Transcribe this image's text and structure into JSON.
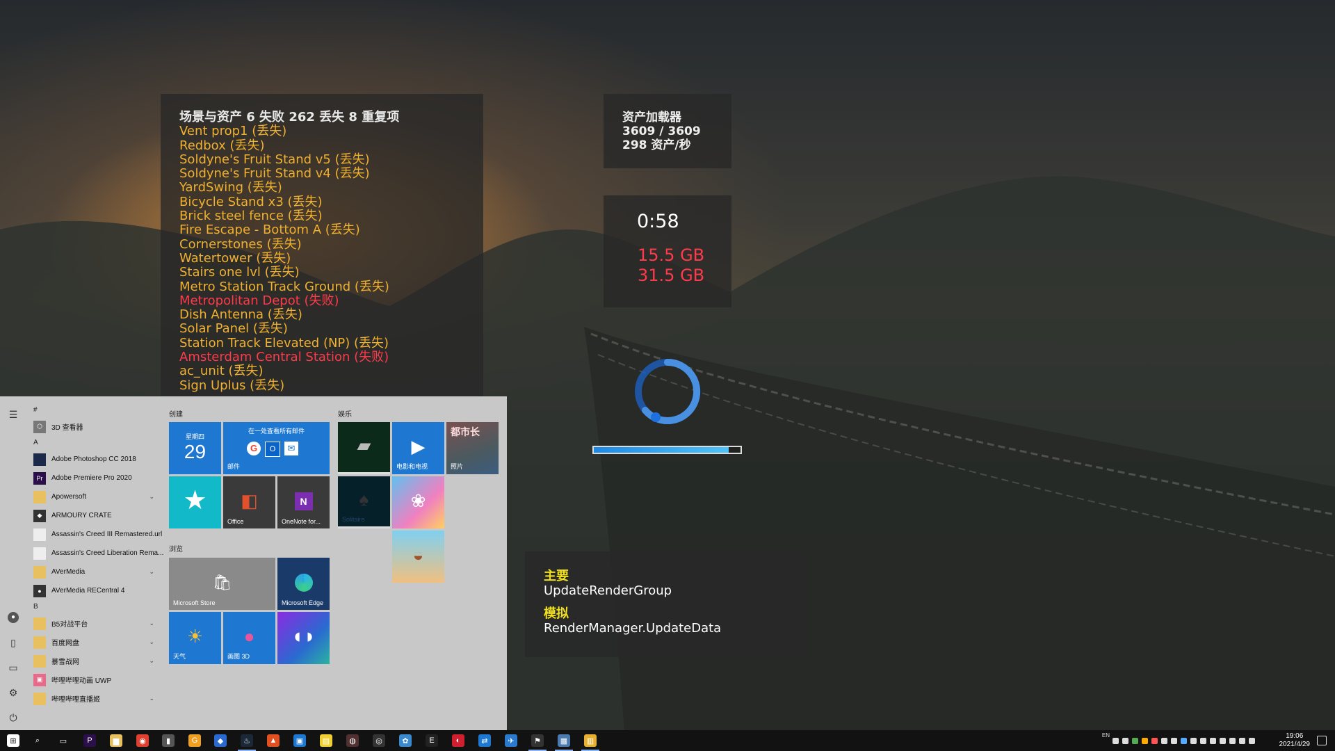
{
  "assets_panel": {
    "header": "场景与资产 6 失败 262 丢失 8 重复项",
    "items": [
      {
        "text": "Vent prop1 (丢失)",
        "status": "ok"
      },
      {
        "text": "Redbox (丢失)",
        "status": "ok"
      },
      {
        "text": "Soldyne's Fruit Stand v5 (丢失)",
        "status": "ok"
      },
      {
        "text": "Soldyne's Fruit Stand v4 (丢失)",
        "status": "ok"
      },
      {
        "text": "YardSwing (丢失)",
        "status": "ok"
      },
      {
        "text": "Bicycle Stand x3 (丢失)",
        "status": "ok"
      },
      {
        "text": "Brick steel fence (丢失)",
        "status": "ok"
      },
      {
        "text": "Fire Escape - Bottom A (丢失)",
        "status": "ok"
      },
      {
        "text": "Cornerstones (丢失)",
        "status": "ok"
      },
      {
        "text": "Watertower (丢失)",
        "status": "ok"
      },
      {
        "text": "Stairs one lvl (丢失)",
        "status": "ok"
      },
      {
        "text": "Metro Station Track Ground (丢失)",
        "status": "ok"
      },
      {
        "text": "Metropolitan Depot (失败)",
        "status": "fail"
      },
      {
        "text": "Dish Antenna (丢失)",
        "status": "ok"
      },
      {
        "text": "Solar Panel (丢失)",
        "status": "ok"
      },
      {
        "text": "Station Track Elevated (NP) (丢失)",
        "status": "ok"
      },
      {
        "text": "Amsterdam Central Station (失败)",
        "status": "fail"
      },
      {
        "text": "ac_unit (丢失)",
        "status": "ok"
      },
      {
        "text": "Sign Uplus (丢失)",
        "status": "ok"
      }
    ]
  },
  "loader": {
    "title": "资产加载器",
    "count": "3609 / 3609",
    "rate": "298 资产/秒"
  },
  "timer": {
    "time": "0:58",
    "mem_used": "15.5 GB",
    "mem_total": "31.5 GB"
  },
  "status": {
    "main_label": "主要",
    "main_value": "UpdateRenderGroup",
    "sim_label": "模拟",
    "sim_value": "RenderManager.UpdateData"
  },
  "progress": {
    "fraction": 0.92
  },
  "start_menu": {
    "apps": [
      {
        "kind": "letter",
        "text": "#"
      },
      {
        "kind": "app",
        "text": "3D 查看器",
        "color": "#777",
        "icon": "cube-icon",
        "glyph": "⬡"
      },
      {
        "kind": "letter",
        "text": "A"
      },
      {
        "kind": "app",
        "text": "Adobe Photoshop CC 2018",
        "color": "#1b2a4a",
        "icon": "photoshop-icon",
        "glyph": ""
      },
      {
        "kind": "app",
        "text": "Adobe Premiere Pro 2020",
        "color": "#2a0f4a",
        "icon": "premiere-icon",
        "glyph": "Pr"
      },
      {
        "kind": "app",
        "text": "Apowersoft",
        "color": "#e8c060",
        "icon": "folder-icon",
        "glyph": "",
        "chevron": true
      },
      {
        "kind": "app",
        "text": "ARMOURY CRATE",
        "color": "#333",
        "icon": "armoury-icon",
        "glyph": "◆"
      },
      {
        "kind": "app",
        "text": "Assassin's Creed III Remastered.url",
        "color": "#eee",
        "icon": "file-icon",
        "glyph": ""
      },
      {
        "kind": "app",
        "text": "Assassin's Creed Liberation Rema...",
        "color": "#eee",
        "icon": "file-icon",
        "glyph": ""
      },
      {
        "kind": "app",
        "text": "AVerMedia",
        "color": "#e8c060",
        "icon": "folder-icon",
        "glyph": "",
        "chevron": true
      },
      {
        "kind": "app",
        "text": "AVerMedia RECentral 4",
        "color": "#333",
        "icon": "recentral-icon",
        "glyph": "●"
      },
      {
        "kind": "letter",
        "text": "B"
      },
      {
        "kind": "app",
        "text": "B5对战平台",
        "color": "#e8c060",
        "icon": "folder-icon",
        "glyph": "",
        "chevron": true
      },
      {
        "kind": "app",
        "text": "百度网盘",
        "color": "#e8c060",
        "icon": "folder-icon",
        "glyph": "",
        "chevron": true
      },
      {
        "kind": "app",
        "text": "暴雪战网",
        "color": "#e8c060",
        "icon": "folder-icon",
        "glyph": "",
        "chevron": true
      },
      {
        "kind": "app",
        "text": "哔哩哔哩动画 UWP",
        "color": "#e86a8a",
        "icon": "bilibili-icon",
        "glyph": "▣"
      },
      {
        "kind": "app",
        "text": "哔哩哔哩直播姬",
        "color": "#e8c060",
        "icon": "folder-icon",
        "glyph": "",
        "chevron": true
      }
    ],
    "groups": {
      "create": "创建",
      "play": "娱乐",
      "browse": "浏览"
    },
    "tiles": {
      "calendar_day": "星期四",
      "calendar_date": "29",
      "mail_header": "在一处查看所有邮件",
      "mail_label": "邮件",
      "office_label": "Office",
      "onenote_label": "OneNote for...",
      "movies_label": "电影和电视",
      "photos_label": "照片",
      "store_label": "Microsoft Store",
      "edge_label": "Microsoft Edge",
      "weather_label": "天气",
      "paint3d_label": "画图 3D",
      "game_text": "都市长",
      "solitaire_label": "Solitaire"
    }
  },
  "taskbar": {
    "lang": "EN",
    "clock_time": "19:06",
    "clock_date": "2021/4/29"
  }
}
